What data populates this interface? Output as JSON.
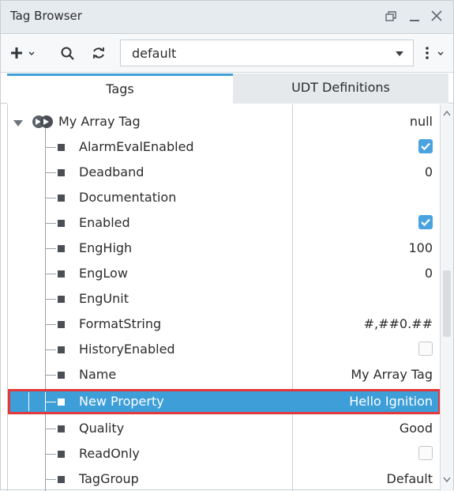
{
  "window": {
    "title": "Tag Browser"
  },
  "titlebar_icons": {
    "restore": "restore-icon",
    "minimize": "minimize-icon",
    "close": "close-icon"
  },
  "toolbar": {
    "add_icon": "plus-icon",
    "search_icon": "search-icon",
    "refresh_icon": "refresh-icon",
    "provider": "default",
    "more_icon": "more-vertical-icon"
  },
  "tabs": [
    {
      "label": "Tags",
      "active": true
    },
    {
      "label": "UDT Definitions",
      "active": false
    }
  ],
  "tree": {
    "root": {
      "label": "My Array Tag",
      "value": "null",
      "icon": "udt-instance-icon"
    },
    "rows": [
      {
        "label": "AlarmEvalEnabled",
        "value": "",
        "checkbox": true
      },
      {
        "label": "Deadband",
        "value": "0"
      },
      {
        "label": "Documentation",
        "value": ""
      },
      {
        "label": "Enabled",
        "value": "",
        "checkbox": true
      },
      {
        "label": "EngHigh",
        "value": "100"
      },
      {
        "label": "EngLow",
        "value": "0"
      },
      {
        "label": "EngUnit",
        "value": ""
      },
      {
        "label": "FormatString",
        "value": "#,##0.##"
      },
      {
        "label": "HistoryEnabled",
        "value": "",
        "checkbox": false
      },
      {
        "label": "Name",
        "value": "My Array Tag"
      },
      {
        "label": "New Property",
        "value": "Hello Ignition",
        "selected": true
      },
      {
        "label": "Quality",
        "value": "Good"
      },
      {
        "label": "ReadOnly",
        "value": "",
        "checkbox": false
      },
      {
        "label": "TagGroup",
        "value": "Default"
      }
    ]
  },
  "colors": {
    "selection": "#3d9ed8",
    "highlight_border": "#e5383b",
    "checkbox_on": "#4aa3df",
    "tab_accent": "#3fa0d8"
  }
}
